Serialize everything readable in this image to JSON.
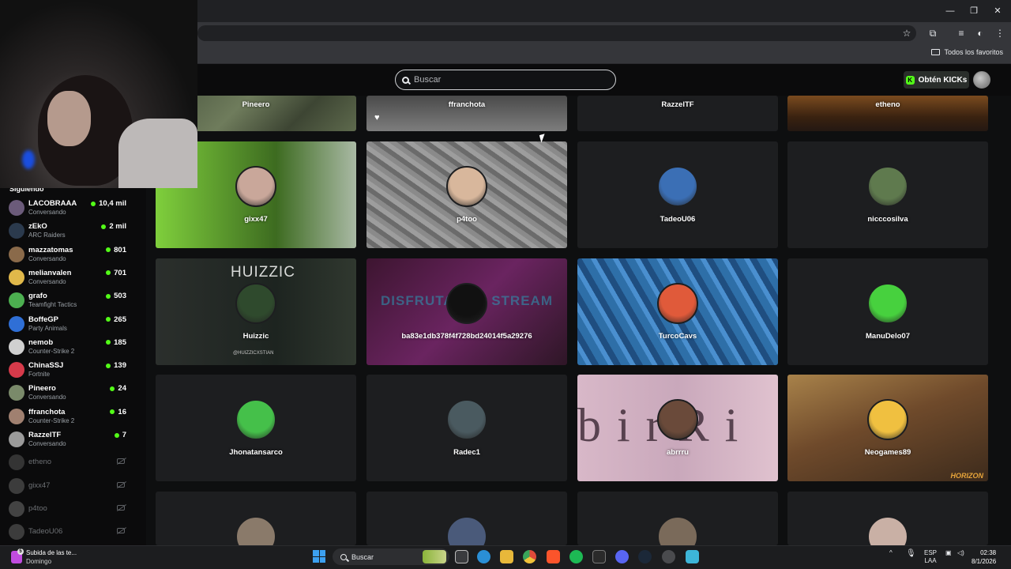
{
  "browser": {
    "bookmarks_all": "Todos los favoritos"
  },
  "kick": {
    "search_placeholder": "Buscar",
    "get_kicks": "Obtén KICKs"
  },
  "sidebar": {
    "title": "Siguiendo",
    "live": [
      {
        "name": "LACOBRAAA",
        "sub": "Conversando",
        "count": "10,4 mil",
        "color": "#6b5b7a"
      },
      {
        "name": "zEkO",
        "sub": "ARC Raiders",
        "count": "2 mil",
        "color": "#2b3a4d"
      },
      {
        "name": "mazzatomas",
        "sub": "Conversando",
        "count": "801",
        "color": "#8a6a4a"
      },
      {
        "name": "melianvalen",
        "sub": "Conversando",
        "count": "701",
        "color": "#e0b84a"
      },
      {
        "name": "grafo",
        "sub": "Teamfight Tactics",
        "count": "503",
        "color": "#4caf50"
      },
      {
        "name": "BoffeGP",
        "sub": "Party Animals",
        "count": "265",
        "color": "#2f6fd6"
      },
      {
        "name": "nemob",
        "sub": "Counter-Strike 2",
        "count": "185",
        "color": "#d0d0d0"
      },
      {
        "name": "ChinaSSJ",
        "sub": "Fortnite",
        "count": "139",
        "color": "#d63a4a"
      },
      {
        "name": "Pineero",
        "sub": "Conversando",
        "count": "24",
        "color": "#7a8a6a"
      },
      {
        "name": "ffranchota",
        "sub": "Counter-Strike 2",
        "count": "16",
        "color": "#a08070"
      },
      {
        "name": "RazzelTF",
        "sub": "Conversando",
        "count": "7",
        "color": "#9a9a9a"
      }
    ],
    "offline": [
      {
        "name": "etheno",
        "color": "#666"
      },
      {
        "name": "gixx47",
        "color": "#777"
      },
      {
        "name": "p4too",
        "color": "#888"
      },
      {
        "name": "TadeoU06",
        "color": "#777"
      }
    ]
  },
  "grid": {
    "top_row": [
      "Pineero",
      "ffranchota",
      "RazzelTF",
      "etheno"
    ],
    "cards": [
      {
        "name": "gixx47",
        "avatar": "#c9a79a"
      },
      {
        "name": "p4too",
        "avatar": "#d8b79c"
      },
      {
        "name": "TadeoU06",
        "avatar": "#3b6fb5"
      },
      {
        "name": "nicccosilva",
        "avatar": "#5f7a4e"
      },
      {
        "name": "Huizzic",
        "avatar": "#2f4a2d"
      },
      {
        "name": "ba83e1db378f4f728bd24014f5a29276",
        "avatar": "#111111"
      },
      {
        "name": "TurcoCavs",
        "avatar": "#e05a3a"
      },
      {
        "name": "ManuDelo07",
        "avatar": "#47d13e"
      },
      {
        "name": "Jhonatansarco",
        "avatar": "#45c04a"
      },
      {
        "name": "Radec1",
        "avatar": "#4a5a60"
      },
      {
        "name": "abrrru",
        "avatar": "#6a4a3a"
      },
      {
        "name": "Neogames89",
        "avatar": "#f0c040"
      }
    ],
    "huizzic_banner": "HUIZZIC",
    "huizzic_handle": "@HUIZZICXSTIAN",
    "magenta_banner": "DISFRUTA DEL STREAM",
    "pink_banner": "birRi",
    "car_banner": "HORIZON"
  },
  "taskbar": {
    "notif_title": "Subida de las te...",
    "notif_sub": "Domingo",
    "notif_badge": "5",
    "search": "Buscar",
    "lang": "ESP",
    "lang2": "LAA",
    "time": "02:38",
    "date": "8/1/2026"
  }
}
